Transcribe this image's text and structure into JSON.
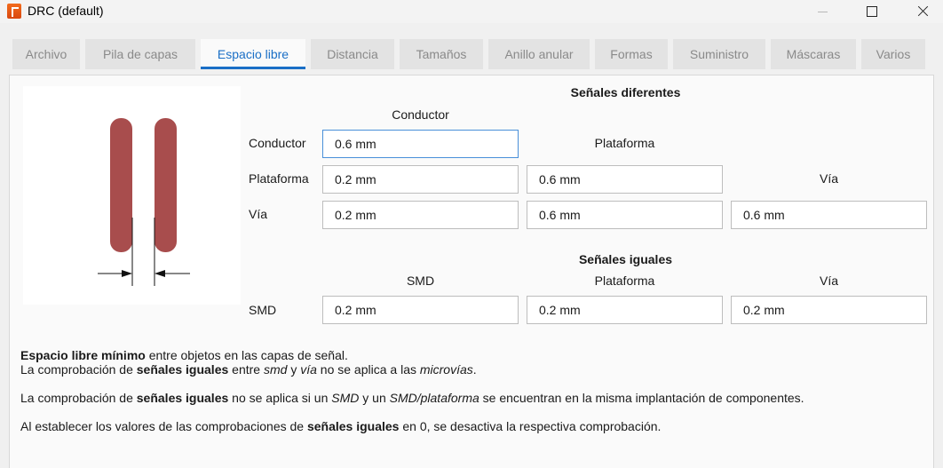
{
  "window": {
    "title": "DRC (default)"
  },
  "tabs": [
    {
      "label": "Archivo",
      "active": false
    },
    {
      "label": "Pila de capas",
      "active": false
    },
    {
      "label": "Espacio libre",
      "active": true
    },
    {
      "label": "Distancia",
      "active": false
    },
    {
      "label": "Tamaños",
      "active": false
    },
    {
      "label": "Anillo anular",
      "active": false
    },
    {
      "label": "Formas",
      "active": false
    },
    {
      "label": "Suministro",
      "active": false
    },
    {
      "label": "Máscaras",
      "active": false
    },
    {
      "label": "Varios",
      "active": false
    }
  ],
  "colors": {
    "accent": "#1a6fc6",
    "trace": "#a84d4d"
  },
  "different": {
    "title": "Señales diferentes",
    "col_conductor": "Conductor",
    "col_pad": "Plataforma",
    "col_via": "Vía",
    "row_conductor": "Conductor",
    "row_pad": "Plataforma",
    "row_via": "Vía",
    "conductor_conductor": "0.6 mm",
    "pad_conductor": "0.2 mm",
    "pad_pad": "0.6 mm",
    "via_conductor": "0.2 mm",
    "via_pad": "0.6 mm",
    "via_via": "0.6 mm"
  },
  "same": {
    "title": "Señales iguales",
    "col_smd": "SMD",
    "col_pad": "Plataforma",
    "col_via": "Vía",
    "row_smd": "SMD",
    "smd_smd": "0.2 mm",
    "smd_pad": "0.2 mm",
    "smd_via": "0.2 mm"
  },
  "description": {
    "p1_b1": "Espacio libre mínimo",
    "p1_t1": " entre objetos en las capas de señal.",
    "p2_t1": "La comprobación de ",
    "p2_b1": "señales iguales",
    "p2_t2": " entre ",
    "p2_i1": "smd",
    "p2_t3": " y ",
    "p2_i2": "vía",
    "p2_t4": " no se aplica a las ",
    "p2_i3": "microvías",
    "p2_t5": ".",
    "p3_t1": "La comprobación de ",
    "p3_b1": "señales iguales",
    "p3_t2": " no se aplica si un ",
    "p3_i1": "SMD",
    "p3_t3": " y un ",
    "p3_i2": "SMD/plataforma",
    "p3_t4": " se encuentran en la misma implantación de componentes.",
    "p4_t1": "Al establecer los valores de las comprobaciones de ",
    "p4_b1": "señales iguales",
    "p4_t2": " en 0, se desactiva la respectiva comprobación."
  }
}
